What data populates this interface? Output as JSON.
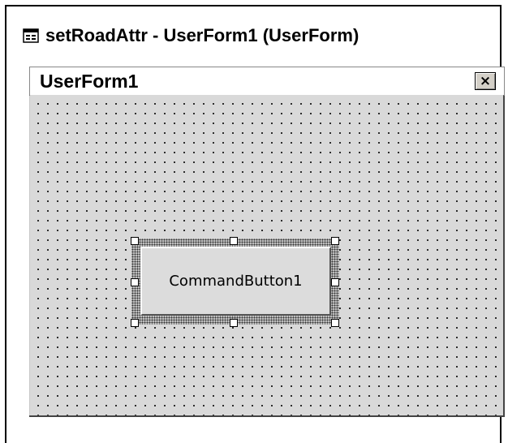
{
  "window": {
    "title": "setRoadAttr - UserForm1 (UserForm)",
    "icon": "form-window-icon"
  },
  "userform": {
    "caption": "UserForm1",
    "close_label": "×",
    "close_icon": "close-icon"
  },
  "controls": [
    {
      "type": "CommandButton",
      "caption": "CommandButton1",
      "selected": true
    }
  ],
  "colors": {
    "form_background": "#d9d9d9",
    "grid_dot": "#000000",
    "button_face": "#dcdcdc"
  }
}
